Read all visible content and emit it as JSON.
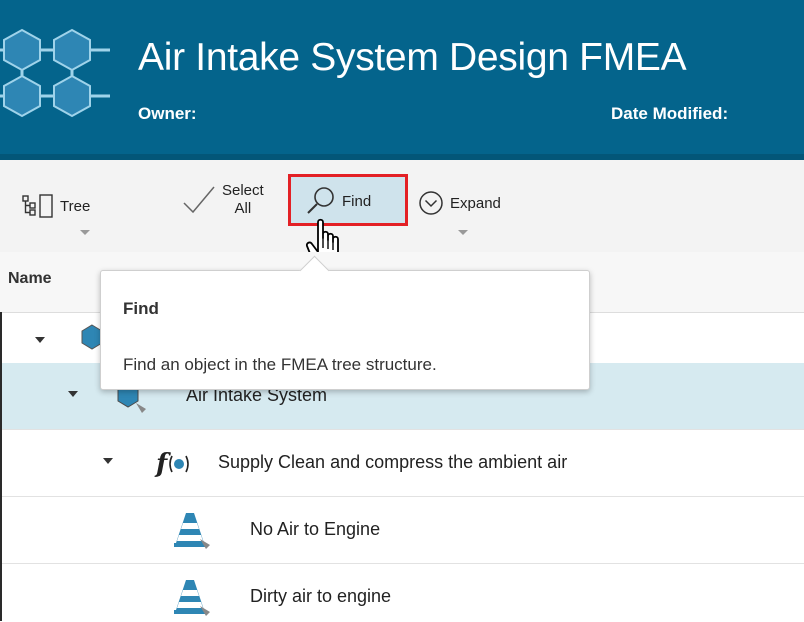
{
  "header": {
    "title": "Air Intake System Design FMEA",
    "owner_label": "Owner:",
    "date_modified_label": "Date Modified:",
    "logo_icon": "hexagon-network-logo"
  },
  "toolbar": {
    "tree_label": "Tree",
    "select_all_line1": "Select",
    "select_all_line2": "All",
    "find_label": "Find",
    "expand_label": "Expand"
  },
  "grid": {
    "name_column": "Name"
  },
  "tooltip": {
    "title": "Find",
    "description": "Find an object in the FMEA tree structure."
  },
  "rows": [
    {
      "label": "",
      "icon": "system-icon"
    },
    {
      "label": "Air Intake System",
      "icon": "system-icon",
      "selected": true
    },
    {
      "label": "Supply Clean and compress the ambient air",
      "icon": "function-icon"
    },
    {
      "label": "No Air to Engine",
      "icon": "failure-cone-icon"
    },
    {
      "label": "Dirty air to engine",
      "icon": "failure-cone-icon"
    }
  ],
  "colors": {
    "header_bg": "#04648c",
    "selected_row": "#d6eaf0",
    "highlight_border": "#e32025"
  }
}
